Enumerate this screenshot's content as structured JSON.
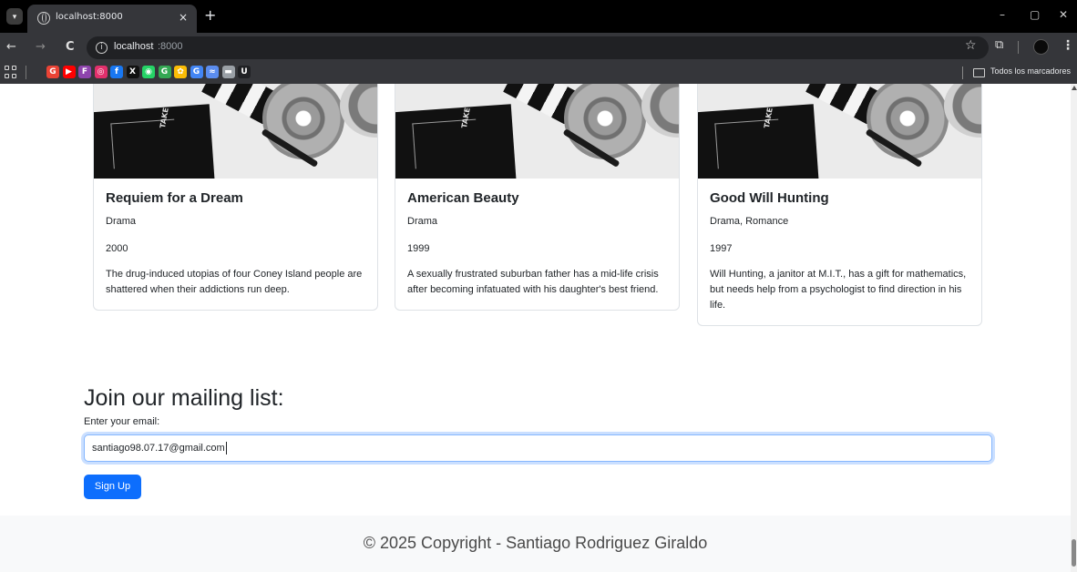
{
  "browser": {
    "tab": {
      "title": "localhost:8000",
      "close": "×"
    },
    "new_tab": "+",
    "window_controls": [
      "–",
      "▢",
      "✕"
    ],
    "nav": {
      "back": "←",
      "forward": "→",
      "reload": "C"
    },
    "address": {
      "host": "localhost",
      "port": ":8000"
    },
    "bookmarks_bar": {
      "icons": [
        {
          "name": "google-icon",
          "glyph": "G",
          "color": "#ea4335"
        },
        {
          "name": "youtube-icon",
          "glyph": "▶",
          "color": "#ff0000"
        },
        {
          "name": "flag-icon",
          "glyph": "F",
          "color": "#8e44ad"
        },
        {
          "name": "instagram-icon",
          "glyph": "◎",
          "color": "#e1306c"
        },
        {
          "name": "facebook-icon",
          "glyph": "f",
          "color": "#1877f2"
        },
        {
          "name": "x-icon",
          "glyph": "X",
          "color": "#111111"
        },
        {
          "name": "whatsapp-icon",
          "glyph": "◉",
          "color": "#25d366"
        },
        {
          "name": "google-green-icon",
          "glyph": "G",
          "color": "#34a853"
        },
        {
          "name": "photos-icon",
          "glyph": "✿",
          "color": "#fbbc05"
        },
        {
          "name": "google-blue-icon",
          "glyph": "G",
          "color": "#4285f4"
        },
        {
          "name": "shortcut-icon",
          "glyph": "≈",
          "color": "#5b8def"
        },
        {
          "name": "mail-icon",
          "glyph": "▬",
          "color": "#9aa0a6"
        },
        {
          "name": "u-icon",
          "glyph": "U",
          "color": "#202124"
        }
      ],
      "all_bookmarks": "Todos los marcadores"
    }
  },
  "movies": [
    {
      "title": "Requiem for a Dream",
      "genre": "Drama",
      "year": "2000",
      "plot": "The drug-induced utopias of four Coney Island people are shattered when their addictions run deep."
    },
    {
      "title": "American Beauty",
      "genre": "Drama",
      "year": "1999",
      "plot": "A sexually frustrated suburban father has a mid-life crisis after becoming infatuated with his daughter's best friend."
    },
    {
      "title": "Good Will Hunting",
      "genre": "Drama, Romance",
      "year": "1997",
      "plot": "Will Hunting, a janitor at M.I.T., has a gift for mathematics, but needs help from a psychologist to find direction in his life."
    }
  ],
  "image_caption": "TAKE",
  "mailing": {
    "heading": "Join our mailing list:",
    "label": "Enter your email:",
    "email_value": "santiago98.07.17@gmail.com",
    "button": "Sign Up"
  },
  "footer": {
    "text": "© 2025 Copyright - Santiago Rodriguez Giraldo"
  },
  "colors": {
    "primary": "#0d6efd",
    "footer_bg": "#f8f9fa",
    "card_border": "#dee2e6"
  }
}
